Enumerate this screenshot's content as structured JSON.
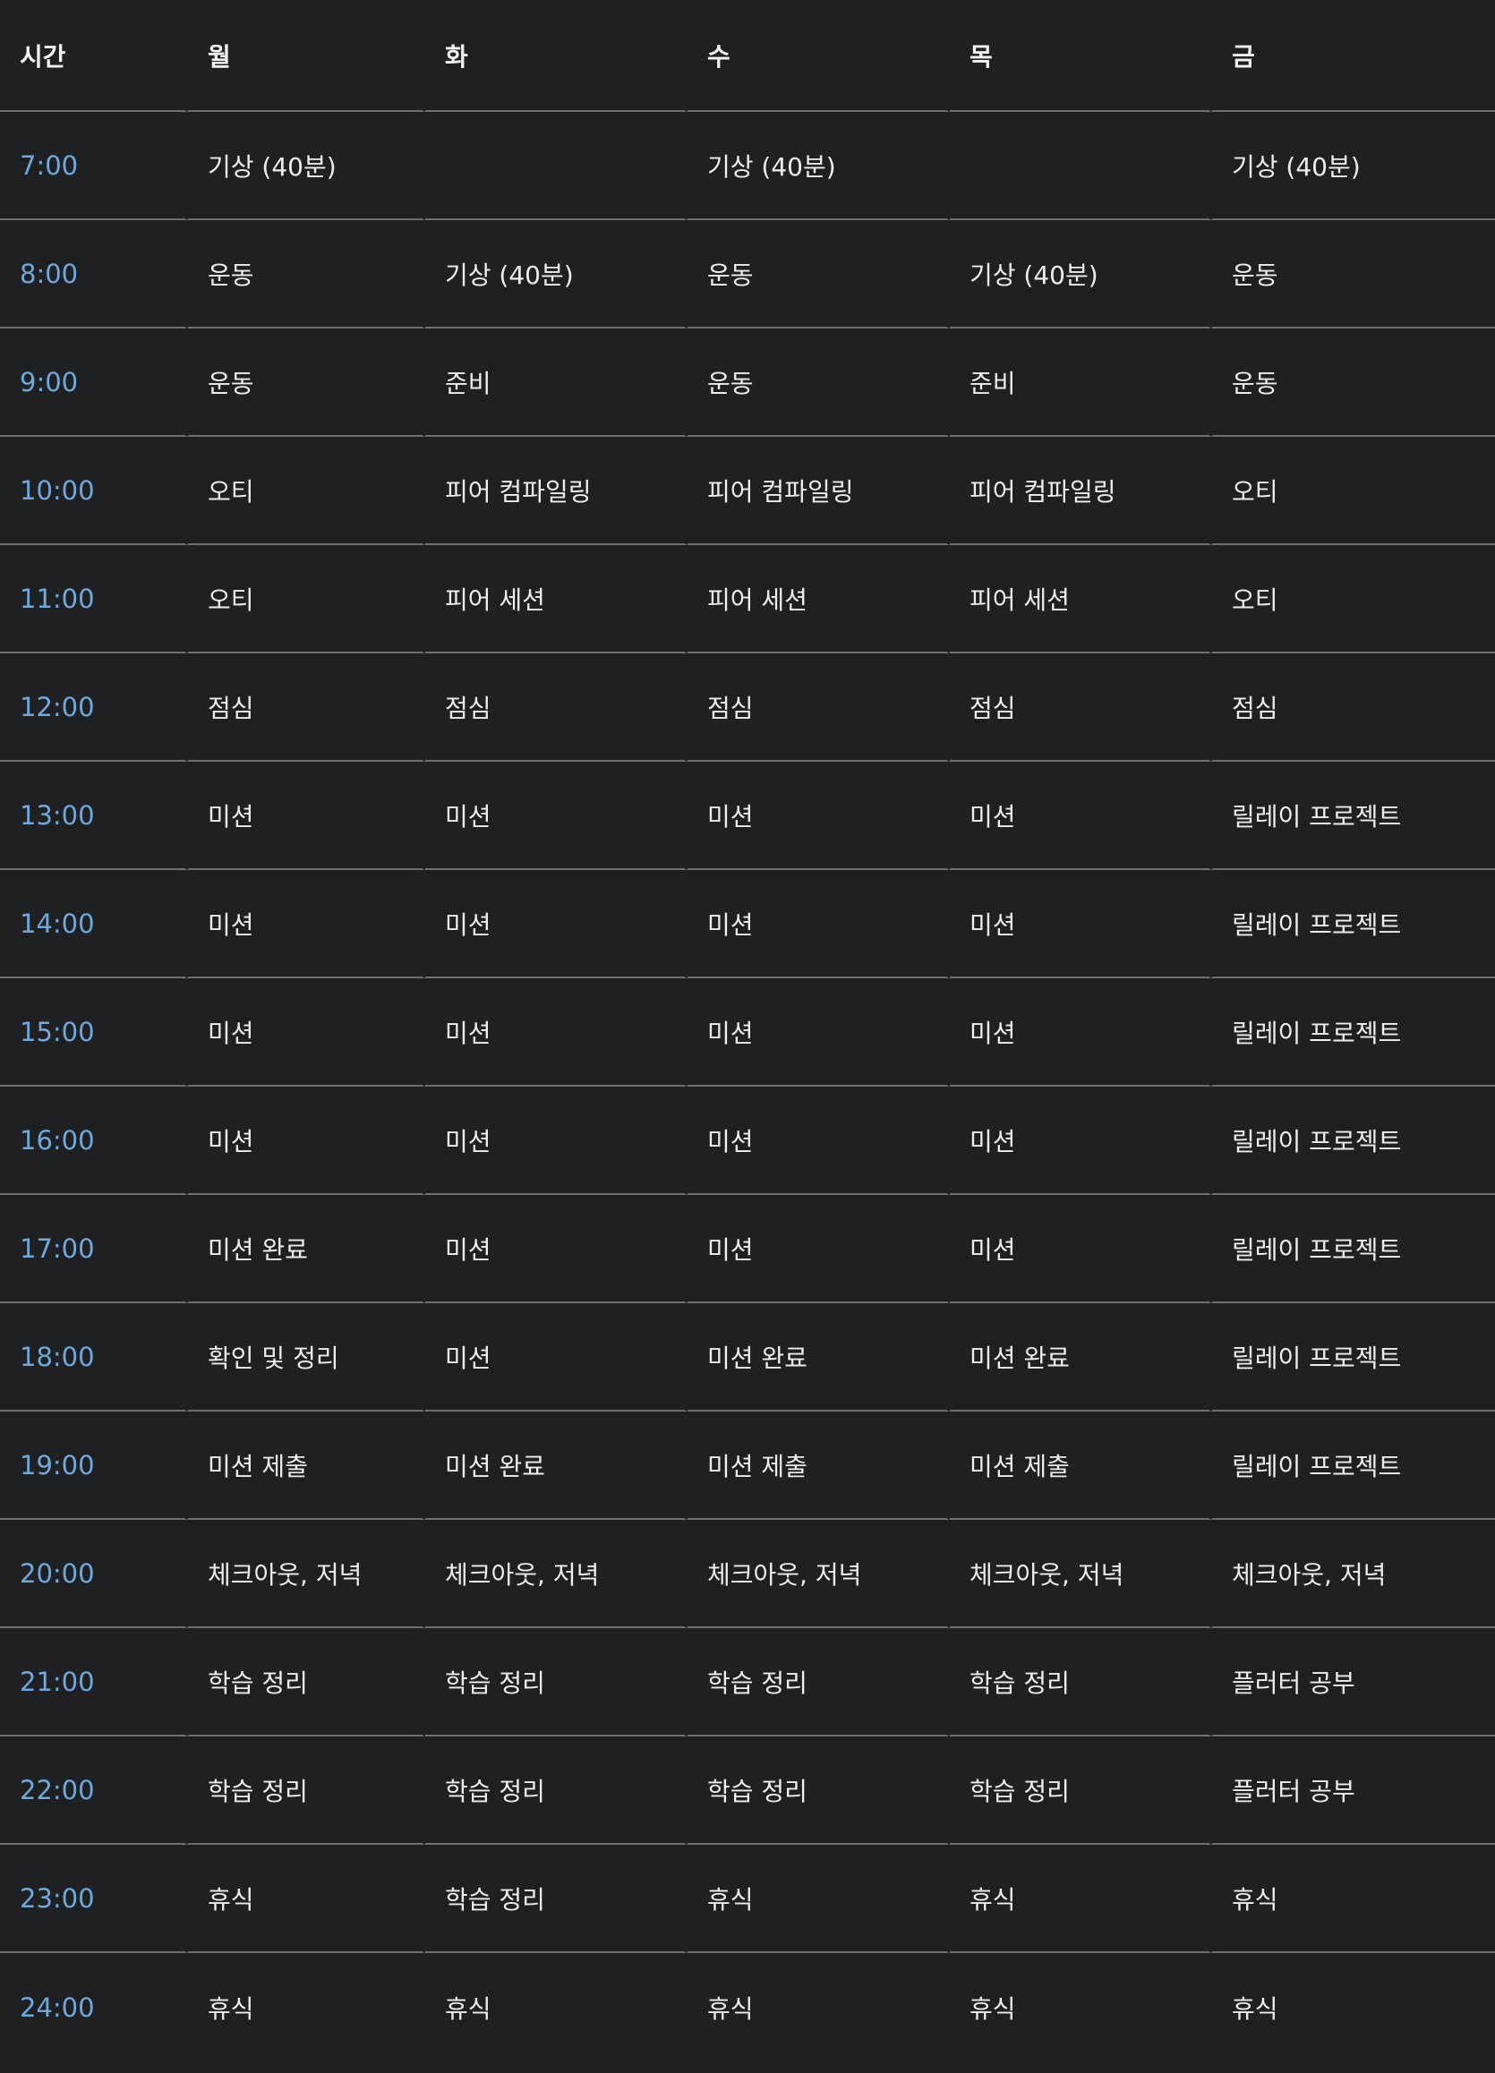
{
  "schedule": {
    "headers": [
      "시간",
      "월",
      "화",
      "수",
      "목",
      "금"
    ],
    "rows": [
      {
        "time": "7:00",
        "cells": [
          "기상 (40분)",
          "",
          "기상 (40분)",
          "",
          "기상 (40분)"
        ]
      },
      {
        "time": "8:00",
        "cells": [
          "운동",
          "기상 (40분)",
          "운동",
          "기상 (40분)",
          "운동"
        ]
      },
      {
        "time": "9:00",
        "cells": [
          "운동",
          "준비",
          "운동",
          "준비",
          "운동"
        ]
      },
      {
        "time": "10:00",
        "cells": [
          "오티",
          "피어 컴파일링",
          "피어 컴파일링",
          "피어 컴파일링",
          "오티"
        ]
      },
      {
        "time": "11:00",
        "cells": [
          "오티",
          "피어 세션",
          "피어 세션",
          "피어 세션",
          "오티"
        ]
      },
      {
        "time": "12:00",
        "cells": [
          "점심",
          "점심",
          "점심",
          "점심",
          "점심"
        ]
      },
      {
        "time": "13:00",
        "cells": [
          "미션",
          "미션",
          "미션",
          "미션",
          "릴레이 프로젝트"
        ]
      },
      {
        "time": "14:00",
        "cells": [
          "미션",
          "미션",
          "미션",
          "미션",
          "릴레이 프로젝트"
        ]
      },
      {
        "time": "15:00",
        "cells": [
          "미션",
          "미션",
          "미션",
          "미션",
          "릴레이 프로젝트"
        ]
      },
      {
        "time": "16:00",
        "cells": [
          "미션",
          "미션",
          "미션",
          "미션",
          "릴레이 프로젝트"
        ]
      },
      {
        "time": "17:00",
        "cells": [
          "미션 완료",
          "미션",
          "미션",
          "미션",
          "릴레이 프로젝트"
        ]
      },
      {
        "time": "18:00",
        "cells": [
          "확인 및 정리",
          "미션",
          "미션 완료",
          "미션 완료",
          "릴레이 프로젝트"
        ]
      },
      {
        "time": "19:00",
        "cells": [
          "미션 제출",
          "미션 완료",
          "미션 제출",
          "미션 제출",
          "릴레이 프로젝트"
        ]
      },
      {
        "time": "20:00",
        "cells": [
          "체크아웃, 저녁",
          "체크아웃, 저녁",
          "체크아웃, 저녁",
          "체크아웃, 저녁",
          "체크아웃, 저녁"
        ]
      },
      {
        "time": "21:00",
        "cells": [
          "학습 정리",
          "학습 정리",
          "학습 정리",
          "학습 정리",
          "플러터 공부"
        ]
      },
      {
        "time": "22:00",
        "cells": [
          "학습 정리",
          "학습 정리",
          "학습 정리",
          "학습 정리",
          "플러터 공부"
        ]
      },
      {
        "time": "23:00",
        "cells": [
          "휴식",
          "학습 정리",
          "휴식",
          "휴식",
          "휴식"
        ]
      },
      {
        "time": "24:00",
        "cells": [
          "휴식",
          "휴식",
          "휴식",
          "휴식",
          "휴식"
        ]
      }
    ]
  },
  "colors": {
    "background": "#1f2022",
    "time_text": "#6fa8dc",
    "cell_text": "#eeeeee",
    "row_divider": "#6f7072"
  }
}
